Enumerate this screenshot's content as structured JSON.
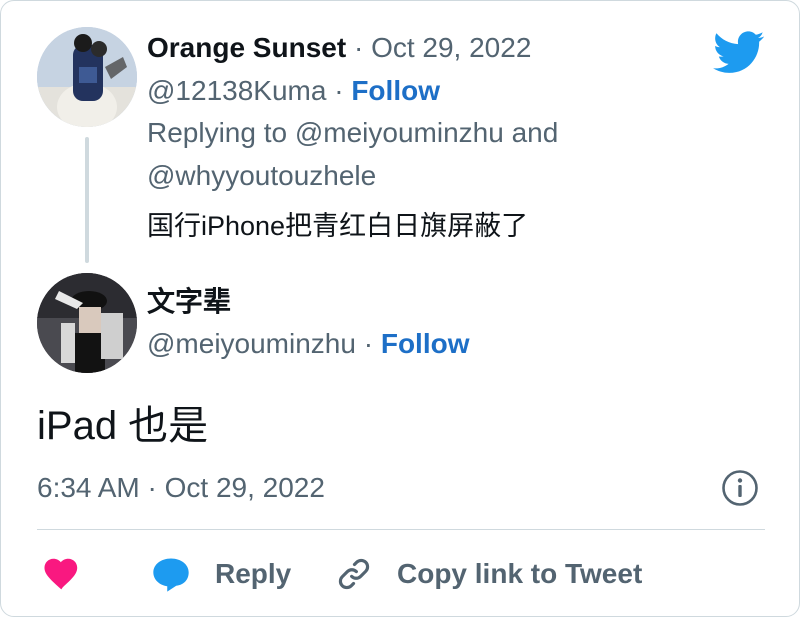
{
  "parent_tweet": {
    "display_name": "Orange Sunset",
    "date": "Oct 29, 2022",
    "handle": "@12138Kuma",
    "follow_label": "Follow",
    "replying_line1": "Replying to @meiyouminzhu and",
    "replying_line2": "@whyyoutouzhele",
    "text": "国行iPhone把青红白日旗屏蔽了"
  },
  "reply_tweet": {
    "display_name": "文字辈",
    "handle": "@meiyouminzhu",
    "follow_label": "Follow",
    "text": "iPad 也是",
    "timestamp": "6:34 AM · Oct 29, 2022"
  },
  "separator": "·",
  "actions": {
    "reply_label": "Reply",
    "copy_link_label": "Copy link to Tweet"
  },
  "colors": {
    "brand_blue": "#1d9bf0",
    "like_pink": "#f91880",
    "muted_text": "#536471",
    "border": "#cfd9de"
  },
  "icons": [
    "twitter-bird-icon",
    "heart-icon",
    "reply-bubble-icon",
    "link-icon",
    "info-icon"
  ]
}
